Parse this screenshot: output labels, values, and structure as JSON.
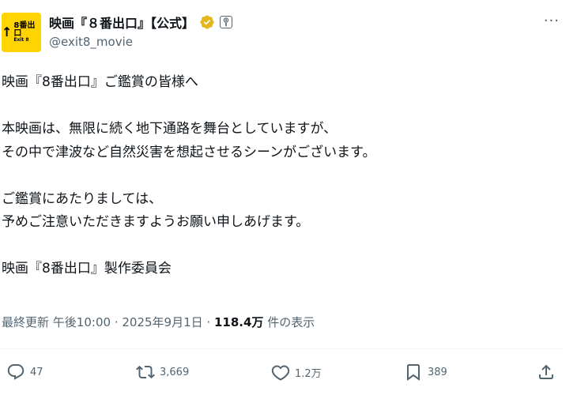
{
  "author": {
    "display_name": "映画『８番出口』【公式】",
    "handle": "@exit8_movie",
    "avatar": {
      "arrow": "↑",
      "logo_top": "8番出口",
      "logo_bottom": "Exit 8",
      "background": "#ffd400"
    },
    "verified_color": "#e2b719"
  },
  "menu": {
    "more_icon": "···"
  },
  "tweet": {
    "paragraphs": [
      "映画『8番出口』ご鑑賞の皆様へ",
      "",
      "本映画は、無限に続く地下通路を舞台としていますが、",
      "その中で津波など自然災害を想起させるシーンがございます。",
      "",
      "ご鑑賞にあたりましては、",
      "予めご注意いただきますようお願い申しあげます。",
      "",
      "映画『8番出口』製作委員会"
    ]
  },
  "meta": {
    "updated_label": "最終更新",
    "time": "午後10:00",
    "separator": "·",
    "date": "2025年9月1日",
    "views_count": "118.4万",
    "views_label": "件の表示"
  },
  "actions": {
    "reply_count": "47",
    "retweet_count": "3,669",
    "like_count": "1.2万",
    "bookmark_count": "389"
  },
  "colors": {
    "text": "#0f1419",
    "secondary": "#536471",
    "divider": "#eff3f4"
  }
}
